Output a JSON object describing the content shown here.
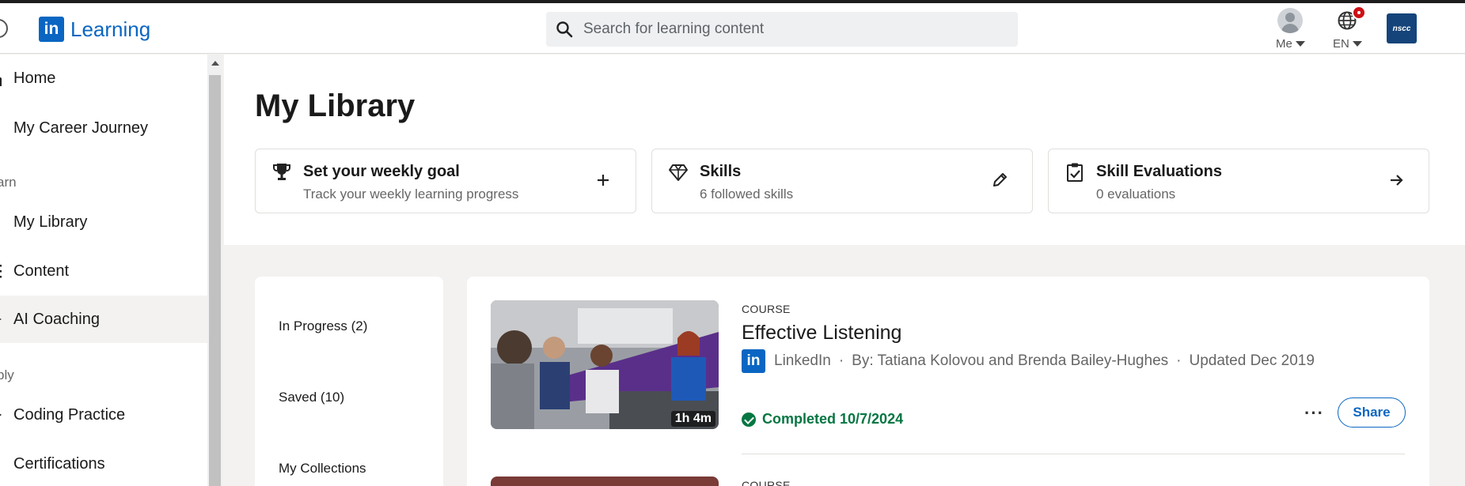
{
  "header": {
    "brand": "Learning",
    "brand_mark": "in",
    "search_placeholder": "Search for learning content",
    "me_label": "Me",
    "lang_label": "EN",
    "org_logo": "nscc"
  },
  "sidebar": {
    "items": [
      {
        "label": "Home",
        "icon": "home-icon"
      },
      {
        "label": "My Career Journey",
        "icon": "journey-icon"
      },
      {
        "label": "My Library",
        "icon": "library-icon"
      },
      {
        "label": "Content",
        "icon": "content-icon"
      },
      {
        "label": "AI Coaching",
        "icon": "ai-coaching-icon"
      },
      {
        "label": "Coding Practice",
        "icon": "coding-icon"
      },
      {
        "label": "Certifications",
        "icon": "certificate-icon"
      }
    ],
    "sections": [
      "arn",
      "ply"
    ],
    "active": "AI Coaching"
  },
  "main": {
    "title": "My Library",
    "cards": [
      {
        "title": "Set your weekly goal",
        "subtitle": "Track your weekly learning progress",
        "icon": "trophy-icon",
        "action": "plus-icon"
      },
      {
        "title": "Skills",
        "subtitle": "6 followed skills",
        "icon": "diamond-icon",
        "action": "pencil-icon"
      },
      {
        "title": "Skill Evaluations",
        "subtitle": "0 evaluations",
        "icon": "clipboard-check-icon",
        "action": "arrow-right-icon"
      }
    ],
    "filters": [
      "In Progress (2)",
      "Saved (10)",
      "My Collections"
    ],
    "course": {
      "type": "COURSE",
      "title": "Effective Listening",
      "provider": "LinkedIn",
      "authors": "By: Tatiana Kolovou and Brenda Bailey-Hughes",
      "updated": "Updated Dec 2019",
      "duration": "1h 4m",
      "completed": "Completed 10/7/2024",
      "more": "···",
      "share": "Share"
    },
    "next_course_type": "COURSE"
  },
  "colors": {
    "brand": "#0a66c2",
    "success": "#057642",
    "badge": "#cc1016"
  }
}
